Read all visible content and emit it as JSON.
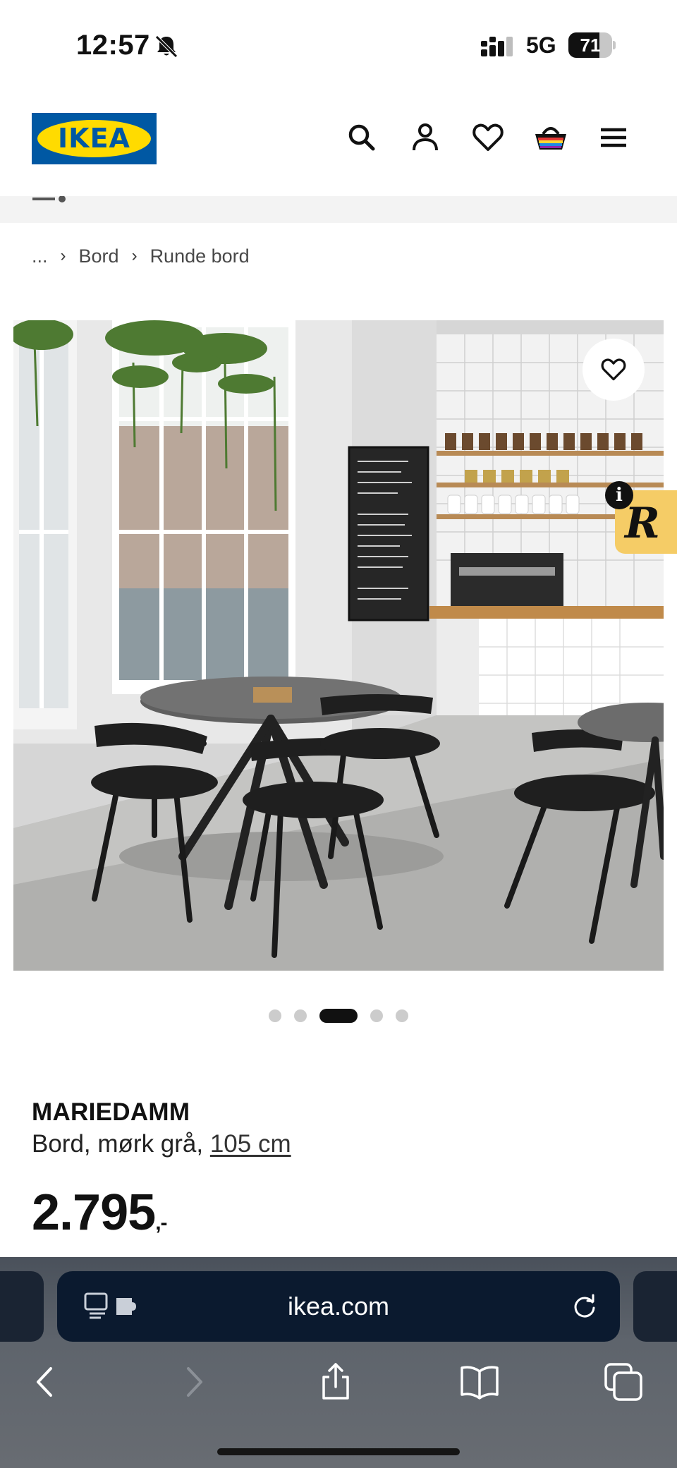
{
  "status_bar": {
    "time": "12:57",
    "network": "5G",
    "battery_level": "71",
    "battery_fraction": 0.71
  },
  "header": {
    "logo_text": "IKEA",
    "icons": [
      "search-icon",
      "profile-icon",
      "heart-icon",
      "basket-icon",
      "menu-icon"
    ]
  },
  "breadcrumb": {
    "items": [
      "...",
      "Bord",
      "Runde bord"
    ]
  },
  "gallery": {
    "dot_count": 5,
    "active_index": 2
  },
  "extension_badge": {
    "letter": "R",
    "info": "i"
  },
  "product": {
    "name": "MARIEDAMM",
    "description": "Bord, mørk grå,",
    "size": "105 cm",
    "price": "2.795",
    "price_suffix": ",-"
  },
  "browser": {
    "url": "ikea.com"
  },
  "colors": {
    "brand_blue": "#0058a3",
    "brand_yellow": "#ffdb00",
    "badge_yellow": "#f5cc66"
  }
}
